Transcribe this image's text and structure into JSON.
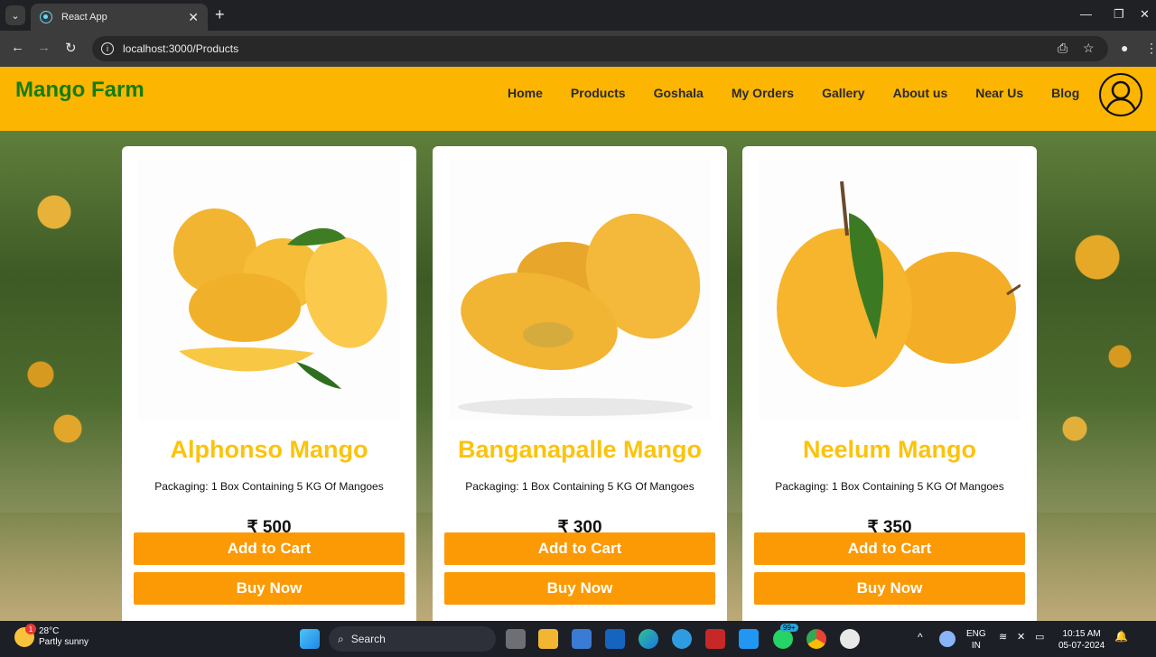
{
  "browser": {
    "tab_title": "React App",
    "url": "localhost:3000/Products"
  },
  "header": {
    "brand": "Mango Farm",
    "nav": [
      "Home",
      "Products",
      "Goshala",
      "My Orders",
      "Gallery",
      "About us",
      "Near Us",
      "Blog"
    ]
  },
  "products": [
    {
      "name": "Alphonso Mango",
      "packaging": "Packaging: 1 Box Containing 5 KG Of Mangoes",
      "price": "₹ 500",
      "cart_label": "Add to Cart",
      "buy_label": "Buy Now"
    },
    {
      "name": "Banganapalle Mango",
      "packaging": "Packaging: 1 Box Containing 5 KG Of Mangoes",
      "price": "₹ 300",
      "cart_label": "Add to Cart",
      "buy_label": "Buy Now"
    },
    {
      "name": "Neelum Mango",
      "packaging": "Packaging: 1 Box Containing 5 KG Of Mangoes",
      "price": "₹ 350",
      "cart_label": "Add to Cart",
      "buy_label": "Buy Now"
    }
  ],
  "taskbar": {
    "weather_temp": "28°C",
    "weather_desc": "Partly sunny",
    "weather_badge": "1",
    "search_label": "Search",
    "whatsapp_badge": "99+",
    "lang_line1": "ENG",
    "lang_line2": "IN",
    "time": "10:15 AM",
    "date": "05-07-2024"
  },
  "colors": {
    "header_bg": "#fcb501",
    "brand": "#147d0f",
    "product_name": "#fcc30c",
    "button": "#fb9a04"
  }
}
